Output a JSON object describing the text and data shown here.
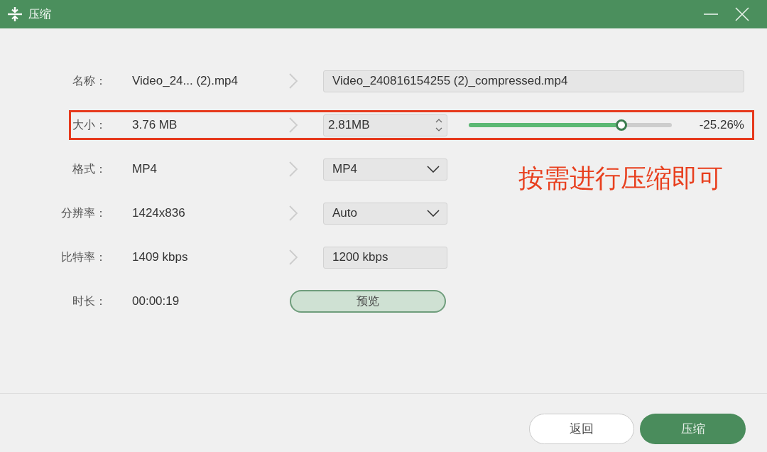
{
  "window": {
    "title": "压缩"
  },
  "rows": [
    {
      "label": "名称：",
      "source": "Video_24... (2).mp4",
      "highlighted": false,
      "target": {
        "kind": "filename",
        "value": "Video_240816154255 (2)_compressed.mp4"
      }
    },
    {
      "label": "大小：",
      "source": "3.76 MB",
      "highlighted": true,
      "target": {
        "kind": "spinner",
        "value": "2.81MB"
      },
      "slider": {
        "level": 0.75
      },
      "reading": "-25.26%"
    },
    {
      "label": "格式：",
      "source": "MP4",
      "highlighted": false,
      "target": {
        "kind": "dropdown",
        "value": "MP4"
      }
    },
    {
      "label": "分辨率：",
      "source": "1424x836",
      "highlighted": false,
      "target": {
        "kind": "dropdown",
        "value": "Auto"
      }
    },
    {
      "label": "比特率：",
      "source": "1409 kbps",
      "highlighted": false,
      "target": {
        "kind": "textfield",
        "value": "1200 kbps"
      }
    },
    {
      "label": "时长：",
      "source": "00:00:19",
      "highlighted": false,
      "target": {
        "kind": "button",
        "value": "预览"
      }
    }
  ],
  "annotation": {
    "text": "按需进行压缩即可"
  },
  "buttons": [
    {
      "label": "返回",
      "kind": "secondary"
    },
    {
      "label": "压缩",
      "kind": "primary"
    }
  ]
}
